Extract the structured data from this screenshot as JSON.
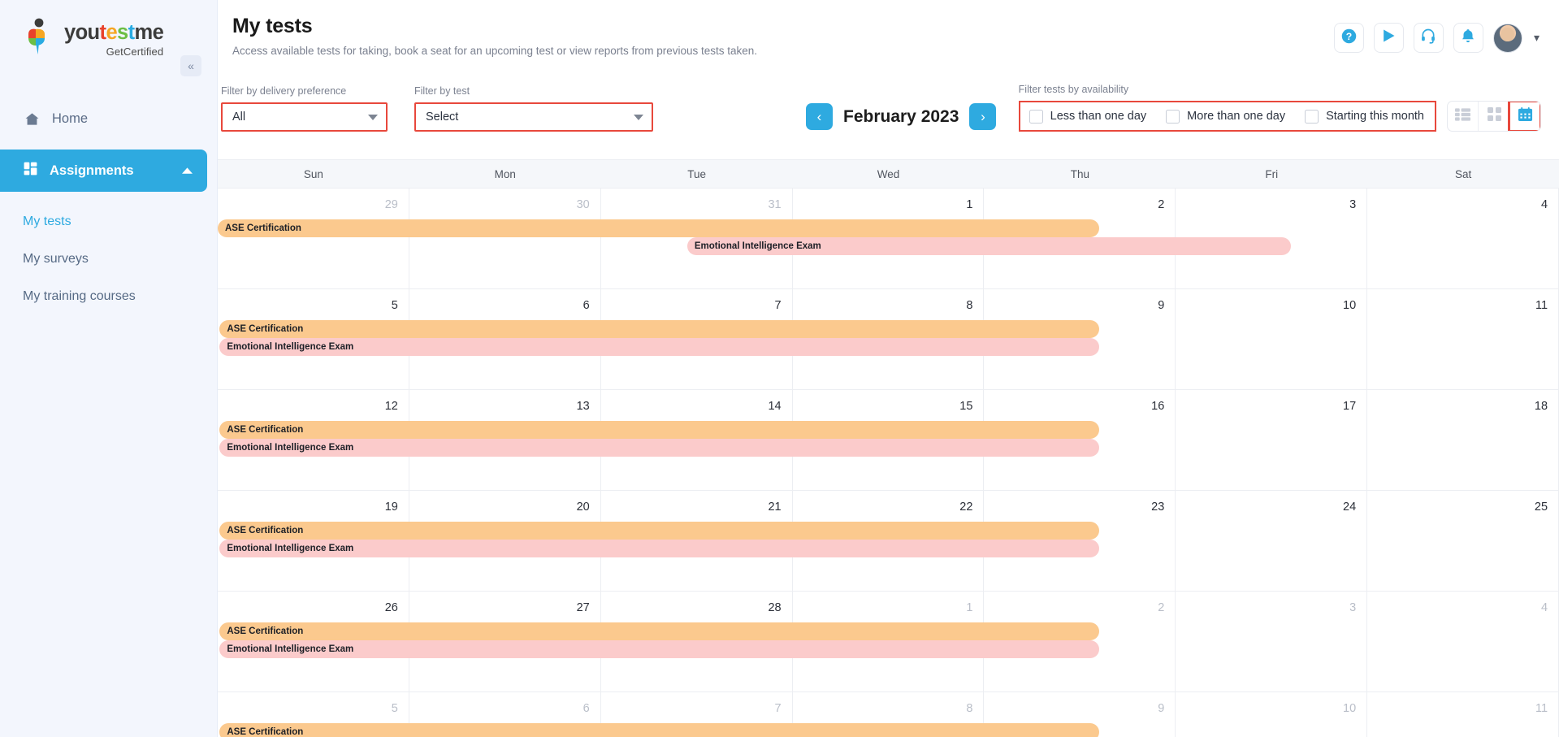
{
  "brand": {
    "logo_you": "you",
    "logo_t": "t",
    "logo_e": "e",
    "logo_s": "s",
    "logo_t2": "t",
    "logo_me": "me",
    "tagline": "GetCertified",
    "accent": "#2eaae0",
    "highlight": "#e8483c"
  },
  "sidebar": {
    "collapse_icon": "double-chevron-left-icon",
    "home": {
      "label": "Home",
      "icon": "home-icon"
    },
    "assignments": {
      "label": "Assignments",
      "icon": "grid-icon",
      "chevron": "chevron-up-icon"
    },
    "subitems": [
      {
        "label": "My tests",
        "selected": true
      },
      {
        "label": "My surveys",
        "selected": false
      },
      {
        "label": "My training courses",
        "selected": false
      }
    ]
  },
  "header": {
    "title": "My tests",
    "subtitle": "Access available tests for taking, book a seat for an upcoming test or view reports from previous tests taken.",
    "icons": [
      {
        "name": "help-icon",
        "glyph": "?"
      },
      {
        "name": "play-icon",
        "glyph": "▶"
      },
      {
        "name": "support-headset-icon",
        "glyph": "☎"
      },
      {
        "name": "notification-bell-icon",
        "glyph": "ὑ4"
      }
    ],
    "avatar_caret": "chevron-down-icon"
  },
  "filters": {
    "delivery": {
      "label": "Filter by delivery preference",
      "value": "All"
    },
    "test": {
      "label": "Filter by test",
      "value": "Select"
    },
    "availability": {
      "label": "Filter tests by availability",
      "options": [
        {
          "label": "Less than one day",
          "checked": false
        },
        {
          "label": "More than one day",
          "checked": false
        },
        {
          "label": "Starting this month",
          "checked": false
        }
      ]
    }
  },
  "month_nav": {
    "prev": "chevron-left-icon",
    "next": "chevron-right-icon",
    "current": "February 2023"
  },
  "view_toggle": {
    "options": [
      {
        "name": "list-view-icon",
        "active": false
      },
      {
        "name": "grid-view-icon",
        "active": false
      },
      {
        "name": "calendar-view-icon",
        "active": true
      }
    ]
  },
  "calendar": {
    "day_headers": [
      "Sun",
      "Mon",
      "Tue",
      "Wed",
      "Thu",
      "Fri",
      "Sat"
    ],
    "weeks": [
      {
        "days": [
          {
            "n": "29",
            "muted": true
          },
          {
            "n": "30",
            "muted": true
          },
          {
            "n": "31",
            "muted": true
          },
          {
            "n": "1",
            "muted": false
          },
          {
            "n": "2",
            "muted": false
          },
          {
            "n": "3",
            "muted": false
          },
          {
            "n": "4",
            "muted": false
          }
        ],
        "events": [
          {
            "label": "ASE Certification",
            "color": "orange",
            "start": 0.0,
            "end": 4.6,
            "row": 0
          },
          {
            "label": "Emotional Intelligence Exam",
            "color": "pink",
            "start": 2.45,
            "end": 5.6,
            "row": 1
          }
        ]
      },
      {
        "days": [
          {
            "n": "5",
            "muted": false
          },
          {
            "n": "6",
            "muted": false
          },
          {
            "n": "7",
            "muted": false
          },
          {
            "n": "8",
            "muted": false
          },
          {
            "n": "9",
            "muted": false
          },
          {
            "n": "10",
            "muted": false
          },
          {
            "n": "11",
            "muted": false
          }
        ],
        "events": [
          {
            "label": "ASE Certification",
            "color": "orange",
            "start": 0.01,
            "end": 4.6,
            "row": 0
          },
          {
            "label": "Emotional Intelligence Exam",
            "color": "pink",
            "start": 0.01,
            "end": 4.6,
            "row": 1
          }
        ]
      },
      {
        "days": [
          {
            "n": "12",
            "muted": false
          },
          {
            "n": "13",
            "muted": false
          },
          {
            "n": "14",
            "muted": false
          },
          {
            "n": "15",
            "muted": false
          },
          {
            "n": "16",
            "muted": false
          },
          {
            "n": "17",
            "muted": false
          },
          {
            "n": "18",
            "muted": false
          }
        ],
        "events": [
          {
            "label": "ASE Certification",
            "color": "orange",
            "start": 0.01,
            "end": 4.6,
            "row": 0
          },
          {
            "label": "Emotional Intelligence Exam",
            "color": "pink",
            "start": 0.01,
            "end": 4.6,
            "row": 1
          }
        ]
      },
      {
        "days": [
          {
            "n": "19",
            "muted": false
          },
          {
            "n": "20",
            "muted": false
          },
          {
            "n": "21",
            "muted": false
          },
          {
            "n": "22",
            "muted": false
          },
          {
            "n": "23",
            "muted": false
          },
          {
            "n": "24",
            "muted": false
          },
          {
            "n": "25",
            "muted": false
          }
        ],
        "events": [
          {
            "label": "ASE Certification",
            "color": "orange",
            "start": 0.01,
            "end": 4.6,
            "row": 0
          },
          {
            "label": "Emotional Intelligence Exam",
            "color": "pink",
            "start": 0.01,
            "end": 4.6,
            "row": 1
          }
        ]
      },
      {
        "days": [
          {
            "n": "26",
            "muted": false
          },
          {
            "n": "27",
            "muted": false
          },
          {
            "n": "28",
            "muted": false
          },
          {
            "n": "1",
            "muted": true
          },
          {
            "n": "2",
            "muted": true
          },
          {
            "n": "3",
            "muted": true
          },
          {
            "n": "4",
            "muted": true
          }
        ],
        "events": [
          {
            "label": "ASE Certification",
            "color": "orange",
            "start": 0.01,
            "end": 4.6,
            "row": 0
          },
          {
            "label": "Emotional Intelligence Exam",
            "color": "pink",
            "start": 0.01,
            "end": 4.6,
            "row": 1
          }
        ]
      },
      {
        "days": [
          {
            "n": "5",
            "muted": true
          },
          {
            "n": "6",
            "muted": true
          },
          {
            "n": "7",
            "muted": true
          },
          {
            "n": "8",
            "muted": true
          },
          {
            "n": "9",
            "muted": true
          },
          {
            "n": "10",
            "muted": true
          },
          {
            "n": "11",
            "muted": true
          }
        ],
        "events": [
          {
            "label": "ASE Certification",
            "color": "orange",
            "start": 0.01,
            "end": 4.6,
            "row": 0
          }
        ]
      }
    ]
  }
}
